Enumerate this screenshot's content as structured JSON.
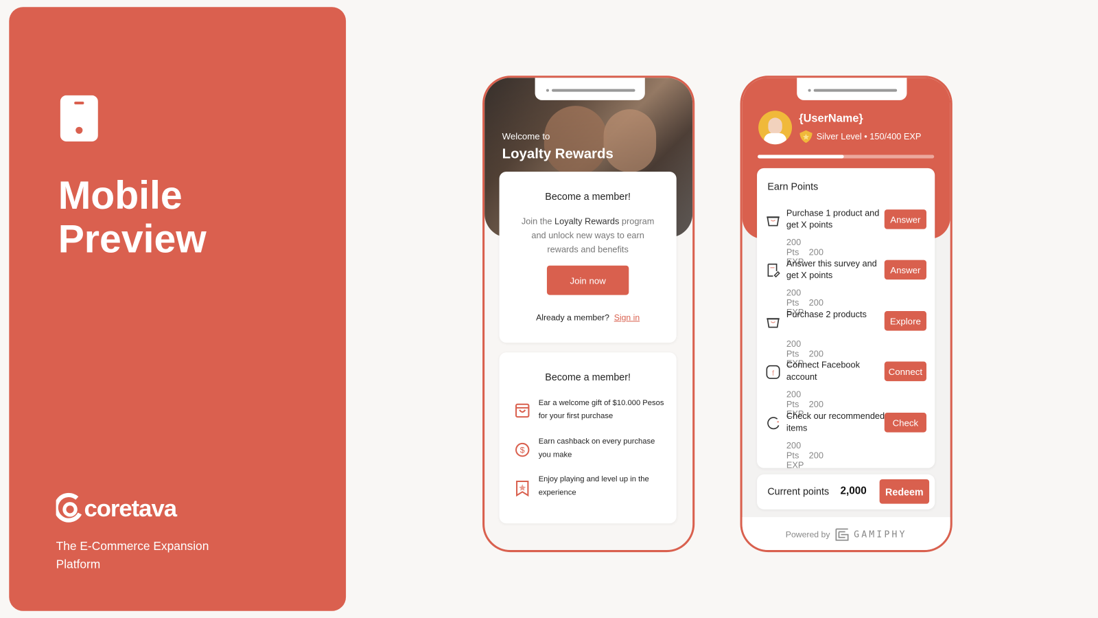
{
  "left_panel": {
    "title_line1": "Mobile",
    "title_line2": "Preview",
    "brand": "coretava",
    "tagline": "The E-Commerce Expansion Platform",
    "bg_color": "#da604f"
  },
  "phone1": {
    "welcome": "Welcome to",
    "program": "Loyalty Rewards",
    "card1": {
      "title": "Become a member!",
      "desc_pre": "Join the ",
      "desc_highlight": "Loyalty Rewards",
      "desc_post": " program and unlock new ways to earn rewards and benefits",
      "join_label": "Join now",
      "already": "Already a member?",
      "signin": "Sign in"
    },
    "card2": {
      "title": "Become a member!",
      "benefits": [
        {
          "icon": "shopping-bag-icon",
          "text": "Ear a welcome gift of $10.000 Pesos for your first purchase"
        },
        {
          "icon": "dollar-coin-icon",
          "text": "Earn cashback on every purchase you make"
        },
        {
          "icon": "star-bookmark-icon",
          "text": "Enjoy playing and level up in the experience"
        }
      ]
    }
  },
  "phone2": {
    "username": "{UserName}",
    "level": "Silver Level • 150/400 EXP",
    "progress_fraction": 0.49,
    "earn_title": "Earn Points",
    "tasks": [
      {
        "icon": "basket-icon",
        "title": "Purchase 1 product and get X points",
        "pts": "200 Pts",
        "exp": "200 EXP",
        "button": "Answer"
      },
      {
        "icon": "survey-icon",
        "title": "Answer this survey and get X points",
        "pts": "200 Pts",
        "exp": "200 EXP",
        "button": "Answer"
      },
      {
        "icon": "basket-icon",
        "title": "Purchase 2 products",
        "pts": "200 Pts",
        "exp": "200 EXP",
        "button": "Explore"
      },
      {
        "icon": "facebook-icon",
        "title": "Connect Facebook account",
        "pts": "200 Pts",
        "exp": "200 EXP",
        "button": "Connect"
      },
      {
        "icon": "loading-icon",
        "title": "Check our recommended items",
        "pts": "200 Pts",
        "exp": "200 EXP",
        "button": "Check"
      }
    ],
    "current_label": "Current points",
    "current_value": "2,000",
    "redeem": "Redeem",
    "powered_by": "Powered by",
    "powered_brand": "GAMIPHY"
  },
  "colors": {
    "accent": "#d9604e",
    "badge": "#f0b93a"
  }
}
